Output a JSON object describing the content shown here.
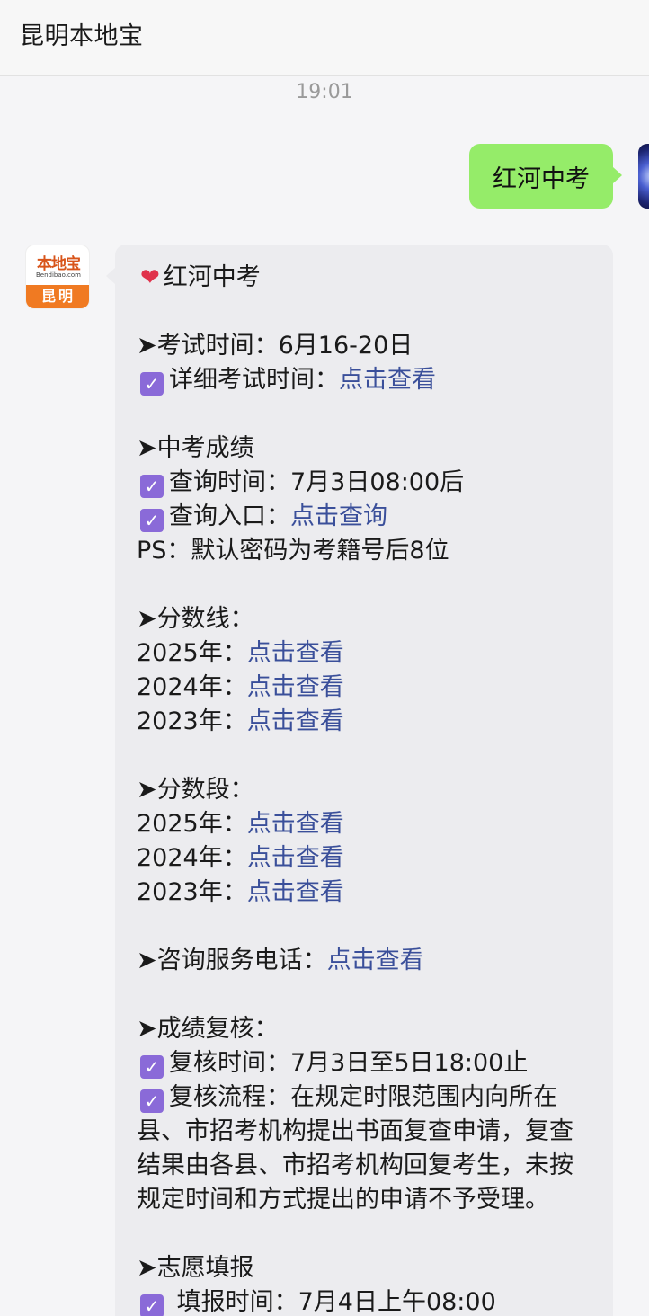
{
  "header": {
    "title": "昆明本地宝"
  },
  "timestamp": "19:01",
  "user_message": {
    "text": "红河中考"
  },
  "bot": {
    "avatar": {
      "logo_text": "本地宝",
      "logo_sub": "Bendibao.com",
      "city": "昆明"
    },
    "message": {
      "title": "红河中考",
      "exam_time": "➤考试时间：6月16-20日",
      "exam_detail_label": "详细考试时间：",
      "exam_detail_link": "点击查看",
      "score_heading": "➤中考成绩",
      "score_query_time": "查询时间：7月3日08:00后",
      "score_query_entry_label": "查询入口：",
      "score_query_entry_link": "点击查询",
      "ps": "PS：默认密码为考籍号后8位",
      "cutoff_heading": "➤分数线：",
      "cutoff": [
        {
          "year": "2025年：",
          "link": "点击查看"
        },
        {
          "year": "2024年：",
          "link": "点击查看"
        },
        {
          "year": "2023年：",
          "link": "点击查看"
        }
      ],
      "segment_heading": "➤分数段：",
      "segment": [
        {
          "year": "2025年：",
          "link": "点击查看"
        },
        {
          "year": "2024年：",
          "link": "点击查看"
        },
        {
          "year": "2023年：",
          "link": "点击查看"
        }
      ],
      "phone_label": "➤咨询服务电话：",
      "phone_link": "点击查看",
      "review_heading": "➤成绩复核：",
      "review_time": "复核时间：7月3日至5日18:00止",
      "review_process_1": "复核流程：在规定时限范围内向所在",
      "review_process_2": "县、市招考机构提出书面复查申请，复查",
      "review_process_3": "结果由各县、市招考机构回复考生，未按",
      "review_process_4": "规定时间和方式提出的申请不予受理。",
      "volunteer_heading": "➤志愿填报",
      "volunteer_time": " 填报时间：7月4日上午08:00"
    }
  },
  "colors": {
    "link": "#3a4f9a",
    "user_bubble": "#95ec69",
    "bot_bubble": "#ececef",
    "check": "#8a6ad8"
  }
}
